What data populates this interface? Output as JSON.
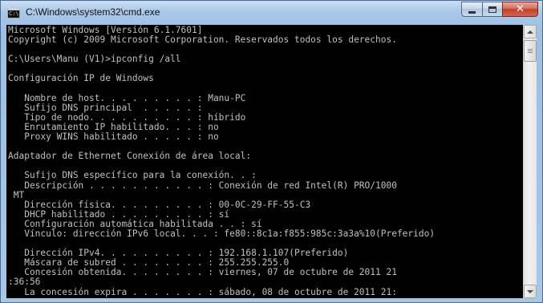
{
  "window": {
    "title": "C:\\Windows\\system32\\cmd.exe",
    "icon": "cmd-icon",
    "icon_prompt": "C:\\",
    "minimize_icon": "minimize-icon",
    "maximize_icon": "maximize-icon",
    "close_label": "✕"
  },
  "console": {
    "lines": [
      "Microsoft Windows [Versión 6.1.7601]",
      "Copyright (c) 2009 Microsoft Corporation. Reservados todos los derechos.",
      "",
      "C:\\Users\\Manu (V1)>ipconfig /all",
      "",
      "Configuración IP de Windows",
      "",
      "   Nombre de host. . . . . . . . . : Manu-PC",
      "   Sufijo DNS principal  . . . . . :",
      "   Tipo de nodo. . . . . . . . . . : híbrido",
      "   Enrutamiento IP habilitado. . . : no",
      "   Proxy WINS habilitado . . . . . : no",
      "",
      "Adaptador de Ethernet Conexión de área local:",
      "",
      "   Sufijo DNS específico para la conexión. . :",
      "   Descripción . . . . . . . . . . . : Conexión de red Intel(R) PRO/1000",
      " MT",
      "   Dirección física. . . . . . . . . : 00-0C-29-FF-55-C3",
      "   DHCP habilitado . . . . . . . . . : sí",
      "   Configuración automática habilitada . . : sí",
      "   Vínculo: dirección IPv6 local. . . : fe80::8c1a:f855:985c:3a3a%10(Preferido)",
      "",
      "   Dirección IPv4. . . . . . . . . . : 192.168.1.107(Preferido)",
      "   Máscara de subred . . . . . . . . : 255.255.255.0",
      "   Concesión obtenida. . . . . . . . : viernes, 07 de octubre de 2011 21",
      ":36:56",
      "   La concesión expira . . . . . . . : sábado, 08 de octubre de 2011 21:"
    ]
  },
  "colors": {
    "console_background": "#000000",
    "console_text": "#c0c0c0",
    "close_button": "#c2412a"
  }
}
